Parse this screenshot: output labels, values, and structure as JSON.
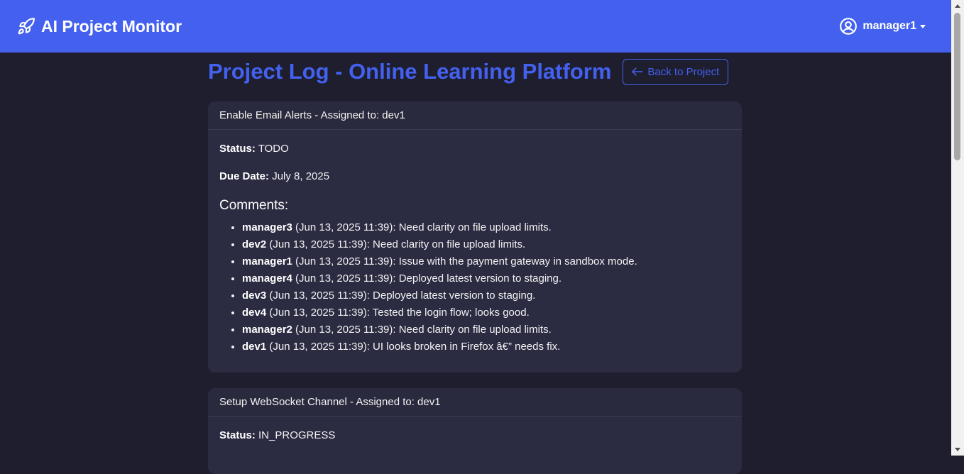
{
  "navbar": {
    "brand": "AI Project Monitor",
    "brand_icon": "rocket-icon",
    "user": "manager1",
    "user_icon": "user-circle-icon",
    "color": "#4361ee"
  },
  "page": {
    "title": "Project Log - Online Learning Platform",
    "back_button": "Back to Project",
    "back_icon": "arrow-left-icon"
  },
  "labels": {
    "status": "Status:",
    "due_date": "Due Date:",
    "comments": "Comments:"
  },
  "tasks": [
    {
      "header": "Enable Email Alerts - Assigned to: dev1",
      "status": "TODO",
      "due_date": "July 8, 2025",
      "comments": [
        {
          "author": "manager3",
          "text": "(Jun 13, 2025 11:39): Need clarity on file upload limits."
        },
        {
          "author": "dev2",
          "text": "(Jun 13, 2025 11:39): Need clarity on file upload limits."
        },
        {
          "author": "manager1",
          "text": "(Jun 13, 2025 11:39): Issue with the payment gateway in sandbox mode."
        },
        {
          "author": "manager4",
          "text": "(Jun 13, 2025 11:39): Deployed latest version to staging."
        },
        {
          "author": "dev3",
          "text": "(Jun 13, 2025 11:39): Deployed latest version to staging."
        },
        {
          "author": "dev4",
          "text": "(Jun 13, 2025 11:39): Tested the login flow; looks good."
        },
        {
          "author": "manager2",
          "text": "(Jun 13, 2025 11:39): Need clarity on file upload limits."
        },
        {
          "author": "dev1",
          "text": "(Jun 13, 2025 11:39): UI looks broken in Firefox â€” needs fix."
        }
      ]
    },
    {
      "header": "Setup WebSocket Channel - Assigned to: dev1",
      "status": "IN_PROGRESS"
    }
  ]
}
